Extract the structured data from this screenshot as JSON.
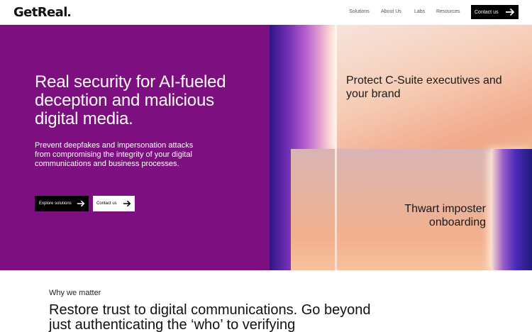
{
  "brand": {
    "logo_text": "GetReal"
  },
  "nav": {
    "links": [
      "Solutions",
      "About Us",
      "Labs",
      "Resources"
    ],
    "cta_label": "Contact us"
  },
  "hero": {
    "title": "Real security for AI-fueled deception and malicious digital media.",
    "subtitle": "Prevent deepfakes and impersonation attacks from compromising the integrity of your digital communications and business processes.",
    "primary_button": "Explore solutions",
    "secondary_button": "Contact us",
    "accent_color": "#7e0f80"
  },
  "cards": {
    "card1": "Protect C-Suite executives and your brand",
    "card2": "Thwart imposter onboarding"
  },
  "section": {
    "eyebrow": "Why we matter",
    "heading": "Restore trust to digital communications. Go beyond just authenticating the ‘who’ to verifying"
  },
  "icons": {
    "arrow": "arrow-right-icon"
  }
}
